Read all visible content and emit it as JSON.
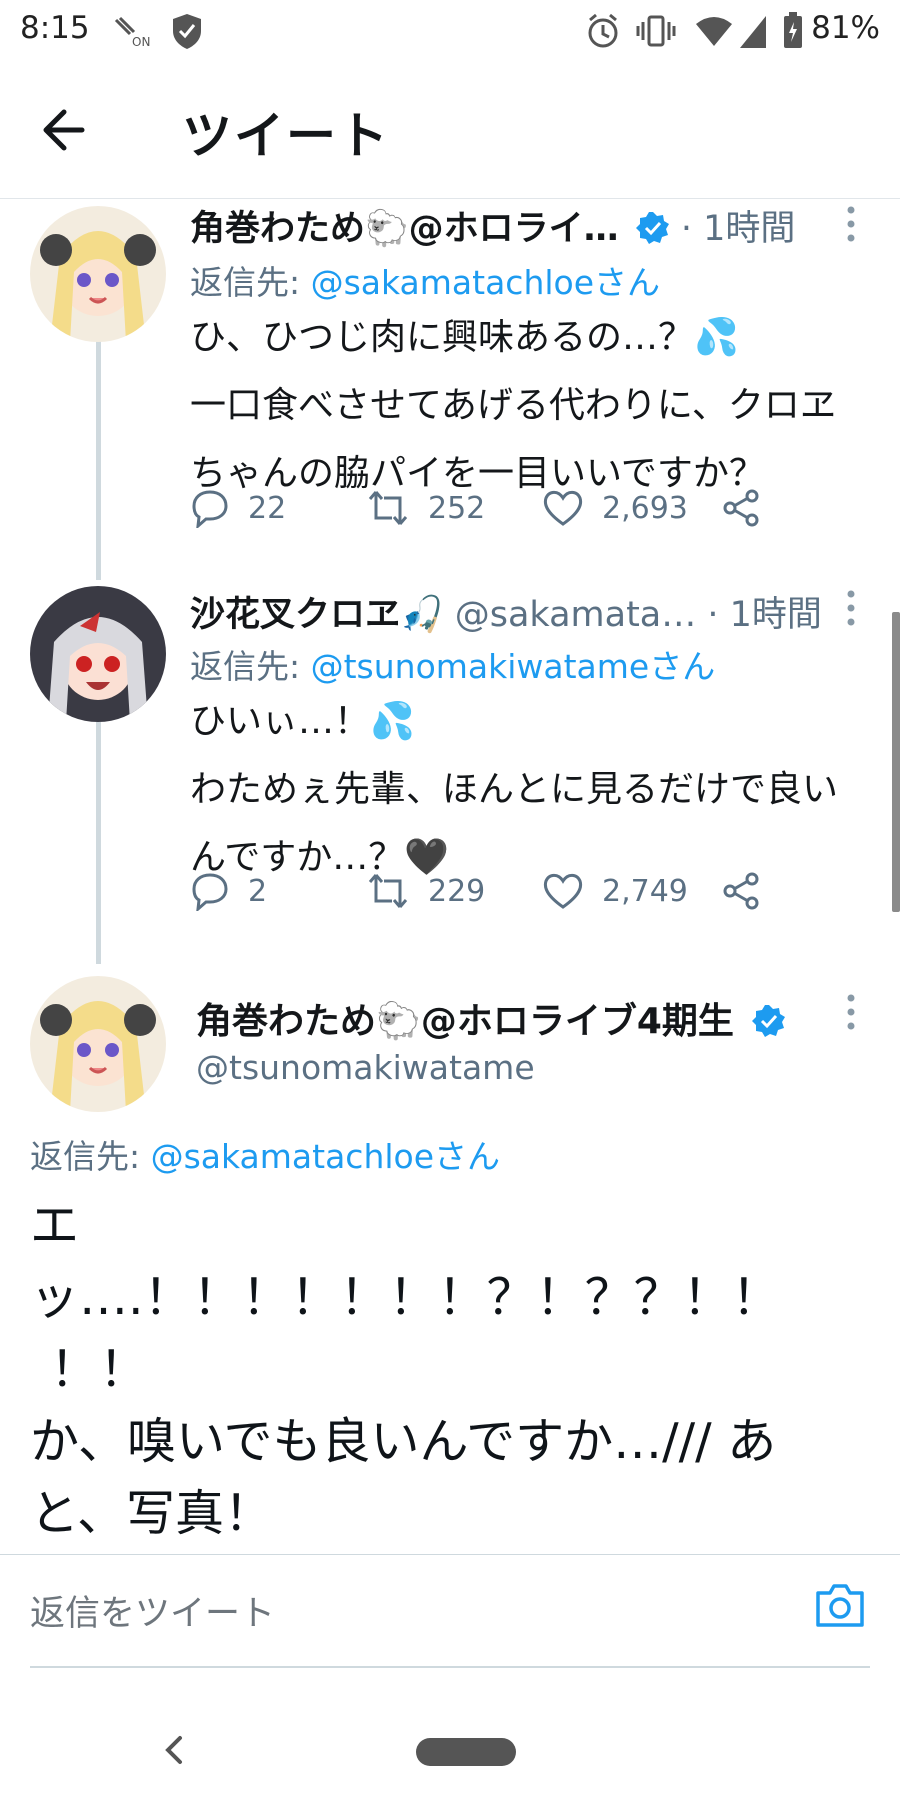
{
  "status_bar": {
    "time": "8:15",
    "nfc_label": "ON",
    "battery": "81%"
  },
  "app_bar": {
    "title": "ツイート"
  },
  "tweets": [
    {
      "name": "角巻わため",
      "name_suffix": "@ホロライ…",
      "handle": "",
      "time": "· 1時間",
      "reply_prefix": "返信先: ",
      "reply_to": "@sakamatachloeさん",
      "lines": [
        "ひ、ひつじ肉に興味あるの…？💦",
        "一口食べさせてあげる代わりに、クロヱ",
        "ちゃんの脇パイを一目いいですか？"
      ],
      "replies": "22",
      "retweets": "252",
      "likes": "2,693"
    },
    {
      "name": "沙花叉クロヱ",
      "name_suffix": "",
      "handle": "@sakamata…",
      "time": "· 1時間",
      "reply_prefix": "返信先: ",
      "reply_to": "@tsunomakiwatameさん",
      "lines": [
        "ひいぃ…！💦",
        "わためぇ先輩、ほんとに見るだけで良い",
        "んですか…？🖤"
      ],
      "replies": "2",
      "retweets": "229",
      "likes": "2,749"
    }
  ],
  "main_tweet": {
    "name": "角巻わため",
    "name_suffix": "@ホロライブ4期生",
    "handle": "@tsunomakiwatame",
    "reply_prefix": "返信先: ",
    "reply_to": "@sakamatachloeさん",
    "lines": [
      "エ",
      "ッ….！！！！！！！？！？？！！",
      "！！",
      "か、嗅いでも良いんですか…/// あ",
      "と、写真！"
    ]
  },
  "composer": {
    "placeholder": "返信をツイート"
  },
  "colors": {
    "accent": "#1d9bf0",
    "secondary_text": "#5b7083",
    "thread_line": "#cfd9de",
    "verified": "#1d9bf0"
  }
}
